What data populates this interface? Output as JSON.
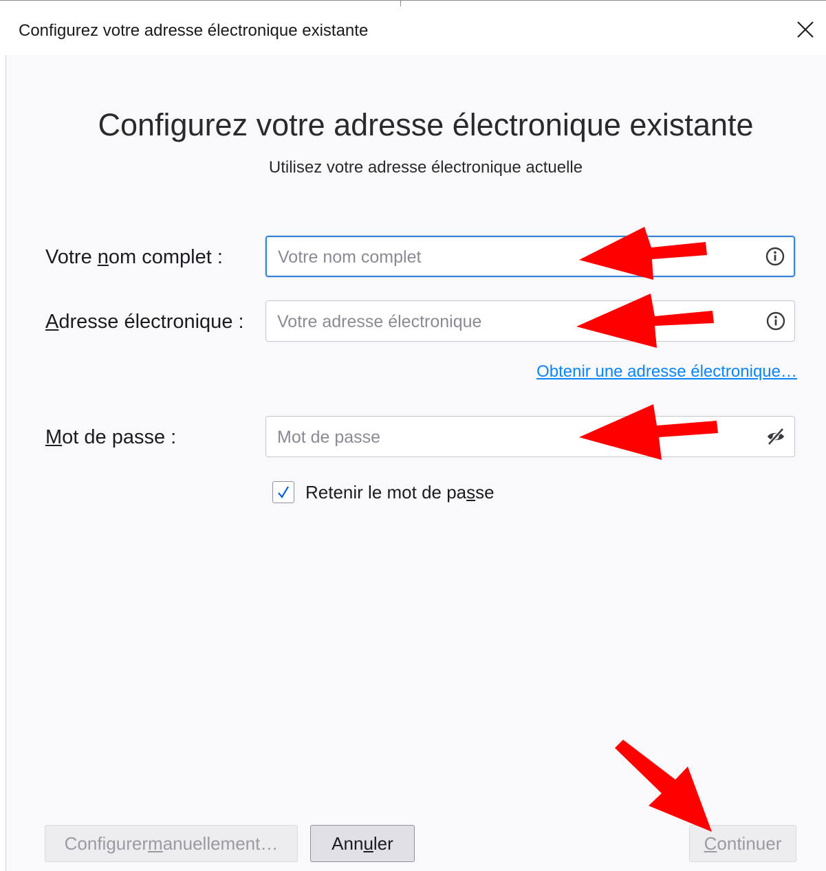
{
  "window": {
    "title": "Configurez votre adresse électronique existante",
    "close_icon": "close-icon"
  },
  "main": {
    "heading": "Configurez votre adresse électronique existante",
    "subtitle": "Utilisez votre adresse électronique actuelle"
  },
  "form": {
    "name": {
      "label_pre": "Votre ",
      "label_accel": "n",
      "label_post": "om complet :",
      "placeholder": "Votre nom complet",
      "value": "",
      "icon": "info-icon"
    },
    "email": {
      "label_pre": "",
      "label_accel": "A",
      "label_post": "dresse électronique :",
      "placeholder": "Votre adresse électronique",
      "value": "",
      "icon": "info-icon"
    },
    "get_email_link": {
      "accel": "O",
      "rest": "btenir une adresse électronique…"
    },
    "password": {
      "label_pre": "",
      "label_accel": "M",
      "label_post": "ot de passe :",
      "placeholder": "Mot de passe",
      "value": "",
      "icon": "eye-slash-icon"
    },
    "remember": {
      "label_pre": "Retenir le mot de pa",
      "label_accel": "s",
      "label_post": "se",
      "checked": true
    }
  },
  "buttons": {
    "manual": {
      "pre": "Configurer ",
      "accel": "m",
      "post": "anuellement…",
      "disabled": true
    },
    "cancel": {
      "pre": "Ann",
      "accel": "u",
      "post": "ler",
      "disabled": false
    },
    "continue": {
      "pre": "",
      "accel": "C",
      "post": "ontinuer",
      "disabled": true
    }
  },
  "colors": {
    "link": "#0a84ff",
    "focus": "#3b82d6",
    "annotation_arrow": "#ff0000"
  }
}
